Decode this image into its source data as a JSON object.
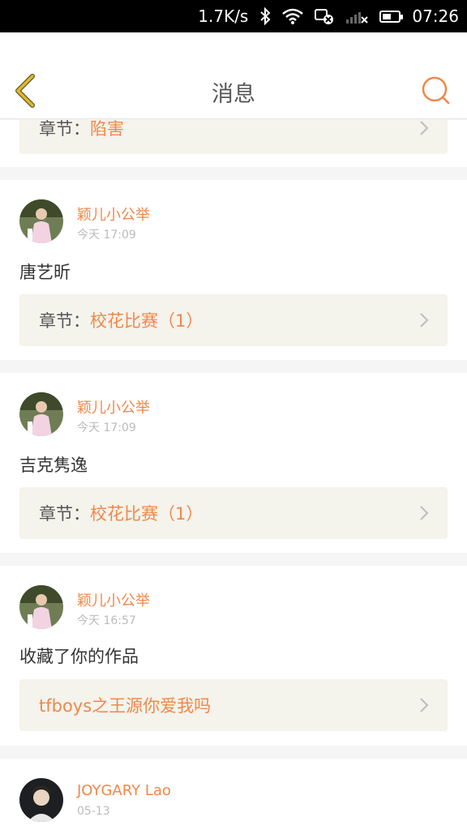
{
  "status_bar": {
    "speed": "1.7K/s",
    "time": "07:26",
    "icons": [
      "bluetooth-icon",
      "wifi-icon",
      "alarm-muted-icon",
      "no-signal-icon",
      "battery-icon"
    ],
    "battery_level": 0.55
  },
  "nav": {
    "title": "消息",
    "back_icon": "chevron-left-icon",
    "search_icon": "search-icon"
  },
  "colors": {
    "accent": "#f0884a",
    "back_arrow": "#d8a728",
    "chapter_bg": "#f4f3ec",
    "divider": "#f5f5f5"
  },
  "top_partial": {
    "chapter_prefix": "章节：",
    "chapter_name": "陷害"
  },
  "messages": [
    {
      "username": "颖儿小公举",
      "time": "今天 17:09",
      "content": "唐艺昕",
      "chapter_prefix": "章节：",
      "chapter_name": "校花比赛（1）"
    },
    {
      "username": "颖儿小公举",
      "time": "今天 17:09",
      "content": "吉克隽逸",
      "chapter_prefix": "章节：",
      "chapter_name": "校花比赛（1）"
    },
    {
      "username": "颖儿小公举",
      "time": "今天 16:57",
      "content": "收藏了你的作品",
      "work_title": "tfboys之王源你爱我吗"
    },
    {
      "username": "JOYGARY Lao",
      "time": "05-13"
    }
  ]
}
